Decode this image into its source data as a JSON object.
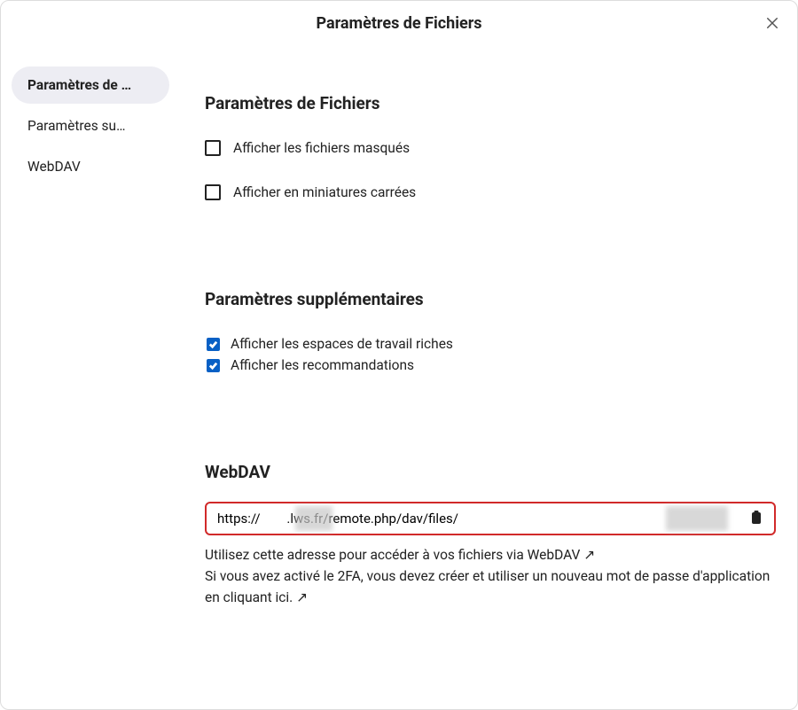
{
  "modal_title": "Paramètres de Fichiers",
  "sidebar": {
    "items": [
      {
        "label": "Paramètres de …",
        "active": true
      },
      {
        "label": "Paramètres su…",
        "active": false
      },
      {
        "label": "WebDAV",
        "active": false
      }
    ]
  },
  "sections": {
    "files": {
      "title": "Paramètres de Fichiers",
      "options": [
        {
          "label": "Afficher les fichiers masqués",
          "checked": false
        },
        {
          "label": "Afficher en miniatures carrées",
          "checked": false
        }
      ]
    },
    "extra": {
      "title": "Paramètres supplémentaires",
      "options": [
        {
          "label": "Afficher les espaces de travail riches",
          "checked": true
        },
        {
          "label": "Afficher les recommandations",
          "checked": true
        }
      ]
    },
    "webdav": {
      "title": "WebDAV",
      "url": "https://        .lws.fr/remote.php/dav/files/",
      "help1": "Utilisez cette adresse pour accéder à vos fichiers via WebDAV ↗",
      "help2": "Si vous avez activé le 2FA, vous devez créer et utiliser un nouveau mot de passe d'application en cliquant ici. ↗"
    }
  }
}
